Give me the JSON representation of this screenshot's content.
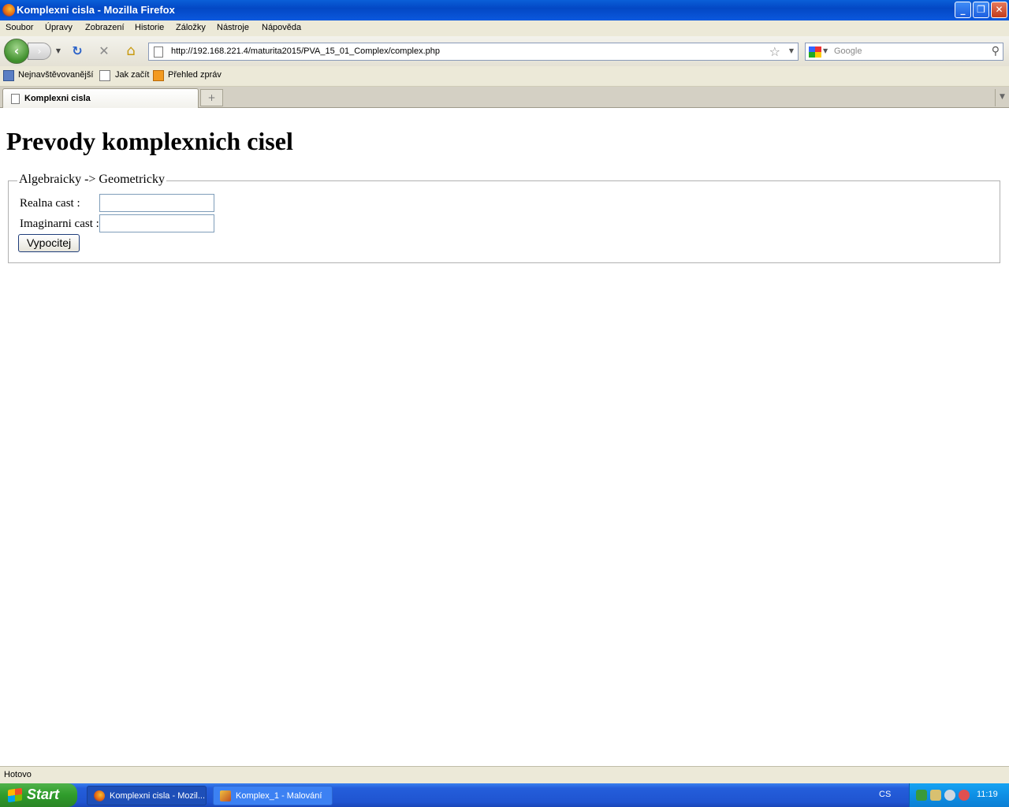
{
  "window": {
    "title": "Komplexni cisla - Mozilla Firefox",
    "controls": {
      "minimize": "_",
      "restore": "❐",
      "close": "✕"
    }
  },
  "menu": [
    "Soubor",
    "Úpravy",
    "Zobrazení",
    "Historie",
    "Záložky",
    "Nástroje",
    "Nápověda"
  ],
  "nav": {
    "url": "http://192.168.221.4/maturita2015/PVA_15_01_Complex/complex.php",
    "search_placeholder": "Google",
    "back_icon": "‹",
    "forward_icon": "›",
    "reload_icon": "↻",
    "stop_icon": "✕",
    "home_icon": "⌂",
    "star_icon": "☆",
    "dropdown_icon": "▼",
    "search_icon": "⚲"
  },
  "bookmarks": [
    "Nejnavštěvovanější",
    "Jak začít",
    "Přehled zpráv"
  ],
  "tabs": {
    "active_label": "Komplexni cisla",
    "new_tab_icon": "+",
    "tab_list_icon": "▼"
  },
  "page": {
    "heading": "Prevody komplexnich cisel",
    "fieldset_legend": "Algebraicky -> Geometricky",
    "real_label": "Realna cast :",
    "imag_label": "Imaginarni cast :",
    "real_value": "",
    "imag_value": "",
    "submit_label": "Vypocitej"
  },
  "status": "Hotovo",
  "taskbar": {
    "start": "Start",
    "tasks": [
      "Komplexni cisla - Mozil...",
      "Komplex_1 - Malování"
    ],
    "language": "CS",
    "clock": "11:19"
  }
}
